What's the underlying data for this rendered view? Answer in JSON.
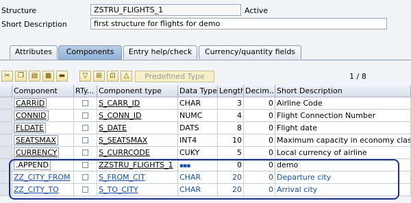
{
  "header": {
    "structure_label": "Structure",
    "structure_value": "ZSTRU_FLIGHTS_1",
    "status": "Active",
    "short_desc_label": "Short Description",
    "short_desc_value": "first structure for flights for demo"
  },
  "tabs": [
    {
      "label": "Attributes",
      "active": false
    },
    {
      "label": "Components",
      "active": true
    },
    {
      "label": "Entry help/check",
      "active": false
    },
    {
      "label": "Currency/quantity fields",
      "active": false
    }
  ],
  "toolbar": {
    "icons": [
      "cut-icon",
      "copy-icon",
      "paste-icon",
      "insert-row-icon",
      "delete-row-icon",
      "filter-icon",
      "insert-icon",
      "new-icon",
      "upload-icon"
    ],
    "predefined_type_label": "Predefined Type",
    "pager": "1 / 8"
  },
  "table": {
    "columns": [
      "Component",
      "RTy...",
      "Component type",
      "Data Type",
      "Length",
      "Decim...",
      "Short Description"
    ],
    "rows": [
      {
        "component": "CARRID",
        "comp_type": "S_CARR_ID",
        "data_type": "CHAR",
        "length": "3",
        "decim": "0",
        "desc": "Airline Code",
        "style": "plain"
      },
      {
        "component": "CONNID",
        "comp_type": "S_CONN_ID",
        "data_type": "NUMC",
        "length": "4",
        "decim": "0",
        "desc": "Flight Connection Number",
        "style": "plain"
      },
      {
        "component": "FLDATE",
        "comp_type": "S_DATE",
        "data_type": "DATS",
        "length": "8",
        "decim": "0",
        "desc": "Flight date",
        "style": "plain"
      },
      {
        "component": "SEATSMAX",
        "comp_type": "S_SEATSMAX",
        "data_type": "INT4",
        "length": "10",
        "decim": "0",
        "desc": "Maximum capacity in economy class",
        "style": "plain"
      },
      {
        "component": "CURRENCY",
        "comp_type": "S_CURRCODE",
        "data_type": "CUKY",
        "length": "5",
        "decim": "0",
        "desc": "Local currency of airline",
        "style": "plain"
      },
      {
        "component": ".APPEND",
        "comp_type": "ZZSTRU_FLIGHTS_1",
        "data_type": "",
        "length": "0",
        "decim": "0",
        "desc": "demo",
        "style": "append"
      },
      {
        "component": "ZZ_CITY_FROM",
        "comp_type": "S_FROM_CIT",
        "data_type": "CHAR",
        "length": "20",
        "decim": "0",
        "desc": "Departure city",
        "style": "link"
      },
      {
        "component": "ZZ_CITY_TO",
        "comp_type": "S_TO_CITY",
        "data_type": "CHAR",
        "length": "20",
        "decim": "0",
        "desc": "Arrival city",
        "style": "link"
      }
    ]
  },
  "colors": {
    "highlight_border": "#1a2f8c",
    "link_blue": "#1a4fa0"
  }
}
